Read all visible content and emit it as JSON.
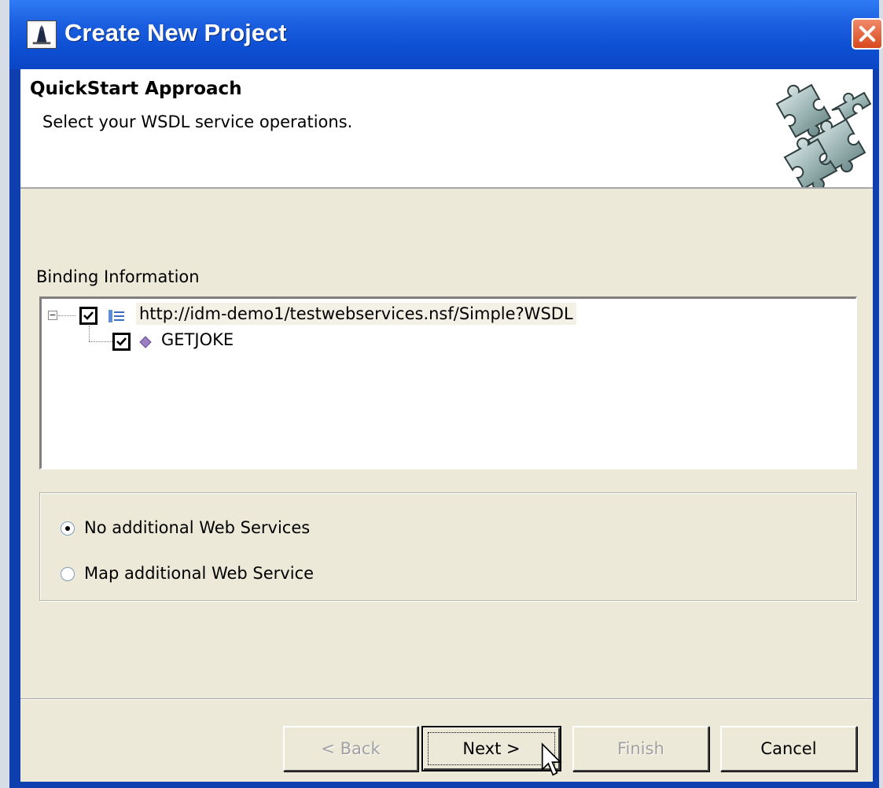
{
  "window": {
    "title": "Create New Project",
    "close_glyph": "✕"
  },
  "header": {
    "title": "QuickStart Approach",
    "description": "Select your WSDL service operations."
  },
  "binding": {
    "label": "Binding Information",
    "tree": {
      "root": {
        "label": "http://idm-demo1/testwebservices.nsf/Simple?WSDL",
        "checked": true,
        "expanded": true,
        "expander_glyph": "−"
      },
      "children": [
        {
          "label": "GETJOKE",
          "checked": true
        }
      ]
    }
  },
  "options": {
    "selected": "none",
    "items": [
      {
        "id": "none",
        "label": "No additional Web Services"
      },
      {
        "id": "map",
        "label": "Map additional Web Service"
      }
    ]
  },
  "buttons": {
    "back": {
      "label": "< Back",
      "enabled": false
    },
    "next": {
      "label": "Next >",
      "enabled": true
    },
    "finish": {
      "label": "Finish",
      "enabled": false
    },
    "cancel": {
      "label": "Cancel",
      "enabled": true
    }
  },
  "colors": {
    "title_bar": "#0a46c4",
    "close_button": "#d8491e",
    "dialog_bg": "#ece9d8",
    "puzzle": "#9fb7b7"
  }
}
